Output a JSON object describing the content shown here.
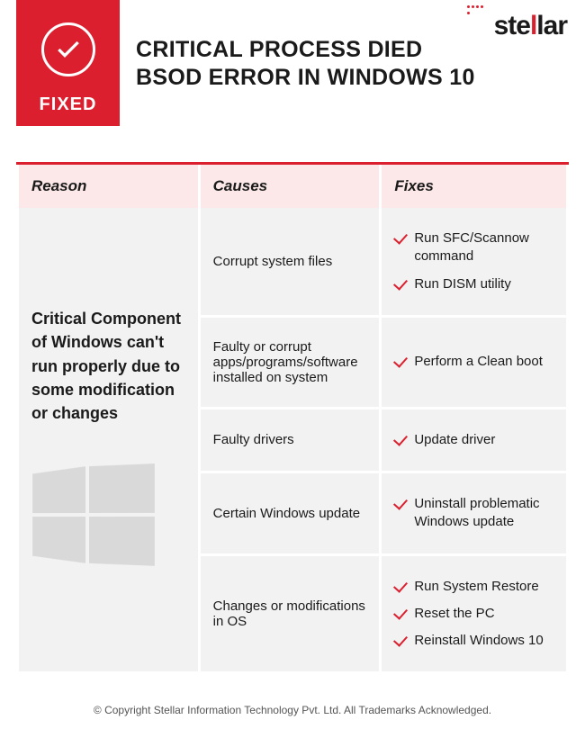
{
  "brand": "stellar",
  "badge": {
    "label": "FIXED"
  },
  "title_line1": "CRITICAL PROCESS DIED",
  "title_line2": "BSOD ERROR IN WINDOWS 10",
  "table": {
    "head": {
      "reason": "Reason",
      "causes": "Causes",
      "fixes": "Fixes"
    },
    "reason_text": "Critical Component of Windows can't run properly due to some modification or changes",
    "rows": [
      {
        "cause": "Corrupt system files",
        "fixes": [
          "Run SFC/Scannow command",
          "Run DISM utility"
        ]
      },
      {
        "cause": "Faulty or corrupt apps/programs/software installed on system",
        "fixes": [
          "Perform a Clean boot"
        ]
      },
      {
        "cause": "Faulty drivers",
        "fixes": [
          "Update driver"
        ]
      },
      {
        "cause": "Certain Windows update",
        "fixes": [
          "Uninstall problematic Windows update"
        ]
      },
      {
        "cause": "Changes or modifications in OS",
        "fixes": [
          "Run System Restore",
          "Reset the PC",
          "Reinstall Windows 10"
        ]
      }
    ]
  },
  "footer": "© Copyright Stellar Information Technology Pvt. Ltd. All Trademarks Acknowledged."
}
